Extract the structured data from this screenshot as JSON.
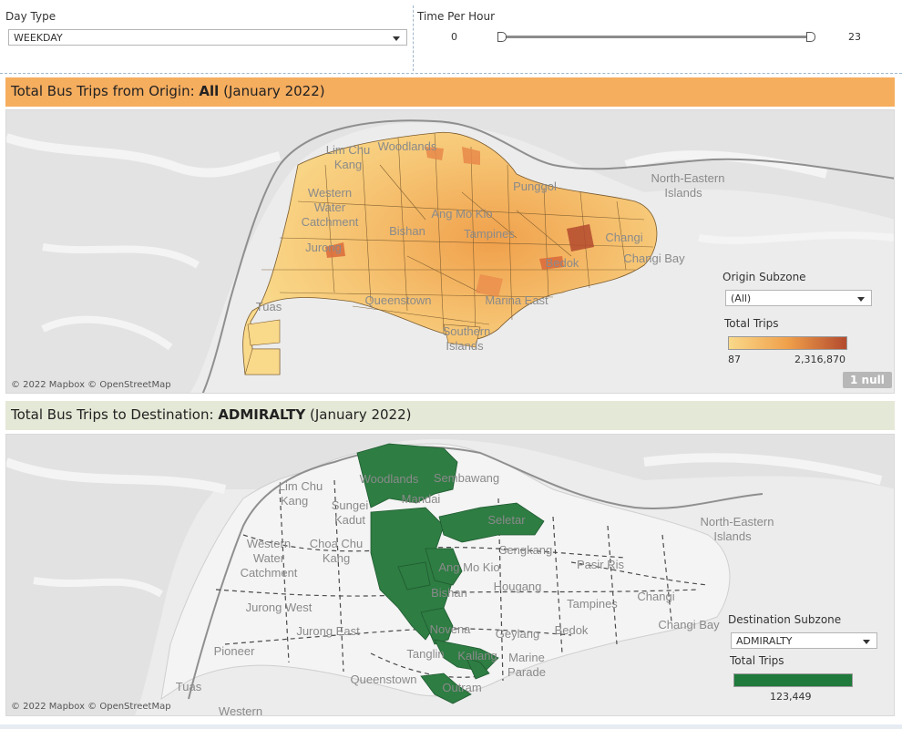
{
  "filters": {
    "day_type_label": "Day Type",
    "day_type_value": "WEEKDAY",
    "time_label": "Time Per Hour",
    "time_min": "0",
    "time_max": "23"
  },
  "origin": {
    "title_prefix": "Total Bus Trips from Origin: ",
    "title_bold": "All",
    "title_suffix": " (January 2022)",
    "subzone_label": "Origin Subzone",
    "subzone_value": "(All)",
    "legend_title": "Total Trips",
    "legend_min": "87",
    "legend_max": "2,316,870",
    "null_badge": "1 null",
    "attribution": "© 2022 Mapbox © OpenStreetMap",
    "place_labels": [
      "Lim Chu Kang",
      "Woodlands",
      "Western Water Catchment",
      "Punggol",
      "North-Eastern Islands",
      "Changi",
      "Changi Bay",
      "Jurong West",
      "Tuas",
      "Queenstown",
      "Marina East",
      "Southern Islands",
      "Ang Mo Kio",
      "Bishan",
      "Tampines",
      "Bedok"
    ],
    "colors": {
      "low": "#f9d98a",
      "mid": "#f0a04b",
      "high": "#b34a2e",
      "banner": "#f5ad5e"
    }
  },
  "destination": {
    "title_prefix": "Total Bus Trips to Destination: ",
    "title_bold": "ADMIRALTY",
    "title_suffix": " (January 2022)",
    "subzone_label": "Destination Subzone",
    "subzone_value": "ADMIRALTY",
    "legend_title": "Total Trips",
    "legend_value": "123,449",
    "attribution": "© 2022 Mapbox © OpenStreetMap",
    "place_labels": [
      "Lim Chu Kang",
      "Woodlands",
      "Sembawang",
      "Sungei Kadut",
      "Mandai",
      "Seletar",
      "North-Eastern Islands",
      "Western Water Catchment",
      "Choa Chu Kang",
      "Sengkang",
      "Pasir Ris",
      "Ang Mo Kio",
      "Hougang",
      "Bishan",
      "Tampines",
      "Changi",
      "Jurong West",
      "Novena",
      "Geylang",
      "Bedok",
      "Changi Bay",
      "Jurong East",
      "Pioneer",
      "Tanglin",
      "Kallang",
      "Marine Parade",
      "Tuas",
      "Queenstown",
      "Outram",
      "Western"
    ],
    "colors": {
      "fill": "#2e7d43",
      "legend": "#1f7a3b",
      "banner": "#e4e8d6"
    }
  }
}
